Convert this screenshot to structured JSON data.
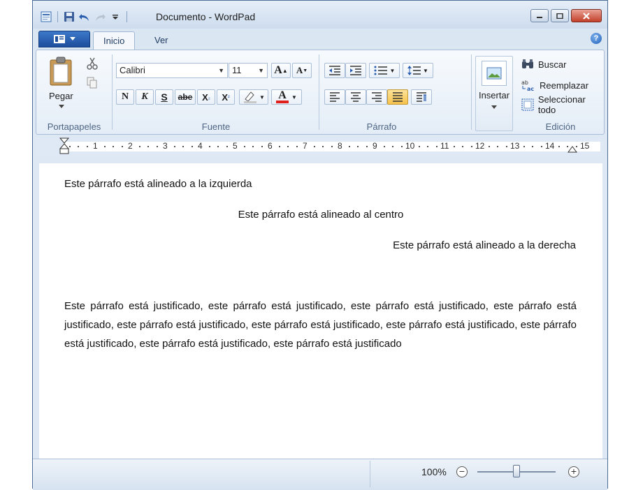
{
  "window": {
    "title": "Documento - WordPad"
  },
  "qat": {
    "icons": [
      "wordpad-app-icon",
      "save-icon",
      "undo-icon",
      "redo-icon",
      "customize-qat-icon"
    ]
  },
  "tabs": [
    {
      "label": "Inicio"
    },
    {
      "label": "Ver"
    }
  ],
  "ribbon": {
    "portapapeles": {
      "group_label": "Portapapeles",
      "paste_label": "Pegar"
    },
    "fuente": {
      "group_label": "Fuente",
      "font_family": "Calibri",
      "font_size": "11",
      "bold": "N",
      "italic": "K",
      "underline": "S",
      "strike": "abe",
      "subscript": "X",
      "superscript": "X",
      "grow_font": "A",
      "shrink_font": "A",
      "font_color_label": "A",
      "font_color": "#e0201c"
    },
    "parrafo": {
      "group_label": "Párrafo"
    },
    "insertar": {
      "label": "Insertar"
    },
    "edicion": {
      "group_label": "Edición",
      "find": "Buscar",
      "replace": "Reemplazar",
      "select_all": "Seleccionar todo"
    }
  },
  "ruler": {
    "numbers": [
      "1",
      "2",
      "3",
      "4",
      "5",
      "6",
      "7",
      "8",
      "9",
      "10",
      "11",
      "12",
      "13",
      "14",
      "15"
    ]
  },
  "document": {
    "p_left": "Este párrafo está alineado a la izquierda",
    "p_center": "Este párrafo está alineado al centro",
    "p_right": "Este párrafo está alineado a la derecha",
    "p_justify": "Este párrafo está justificado, este párrafo está justificado, este párrafo está justificado, este párrafo está justificado, este párrafo está justificado, este párrafo está justificado, este párrafo está justificado, este párrafo está justificado, este párrafo está justificado, este párrafo está justificado"
  },
  "status": {
    "zoom": "100%",
    "zoom_level": 1.0
  },
  "colors": {
    "accent": "#1c4e9c",
    "highlight_active": "#f6c24b",
    "close_button": "#c2402a"
  }
}
